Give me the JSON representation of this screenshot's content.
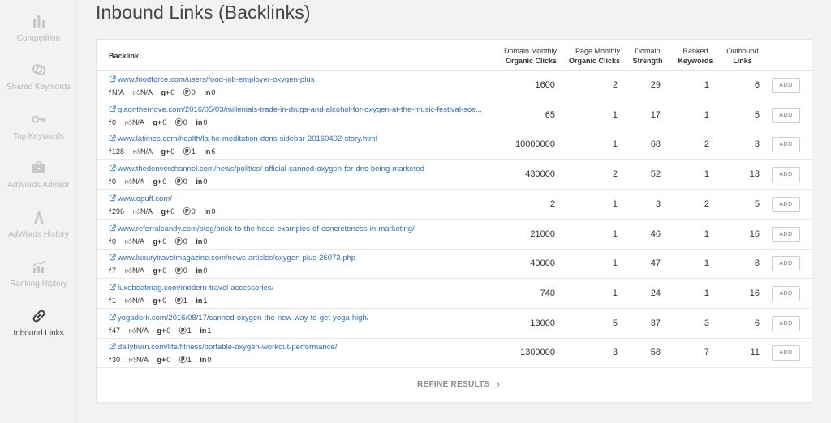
{
  "page_title": "Inbound Links (Backlinks)",
  "sidebar": {
    "items": [
      {
        "label": "Competition",
        "icon": "bar-chart-icon"
      },
      {
        "label": "Shared Keywords",
        "icon": "shared-keywords-icon"
      },
      {
        "label": "Top Keywords",
        "icon": "key-icon"
      },
      {
        "label": "AdWords Advisor",
        "icon": "briefcase-icon"
      },
      {
        "label": "AdWords History",
        "icon": "adwords-icon"
      },
      {
        "label": "Ranking History",
        "icon": "ranking-chart-icon"
      },
      {
        "label": "Inbound Links",
        "icon": "link-icon",
        "active": true
      }
    ]
  },
  "table": {
    "headers": {
      "backlink": "Backlink",
      "domain_monthly_1": "Domain Monthly",
      "domain_monthly_2": "Organic Clicks",
      "page_monthly_1": "Page Monthly",
      "page_monthly_2": "Organic Clicks",
      "domain_strength_1": "Domain",
      "domain_strength_2": "Strength",
      "ranked_keywords_1": "Ranked",
      "ranked_keywords_2": "Keywords",
      "outbound_links_1": "Outbound",
      "outbound_links_2": "Links"
    },
    "add_label": "ADD",
    "rows": [
      {
        "url": "www.foodforce.com/users/food-job-employer-oxygen-plus",
        "fb": "N/A",
        "like": "N/A",
        "gplus": "0",
        "pin": "0",
        "li": "0",
        "domain_clicks": "1600",
        "page_clicks": "2",
        "strength": "29",
        "ranked": "1",
        "outbound": "6"
      },
      {
        "url": "giaonthemove.com/2016/05/03/millenials-trade-in-drugs-and-alcohol-for-oxygen-at-the-music-festival-sce...",
        "fb": "0",
        "like": "N/A",
        "gplus": "0",
        "pin": "0",
        "li": "0",
        "domain_clicks": "65",
        "page_clicks": "1",
        "strength": "17",
        "ranked": "1",
        "outbound": "5"
      },
      {
        "url": "www.latimes.com/health/la-he-meditation-dens-sidebar-20160402-story.html",
        "fb": "128",
        "like": "N/A",
        "gplus": "0",
        "pin": "1",
        "li": "6",
        "domain_clicks": "10000000",
        "page_clicks": "1",
        "strength": "68",
        "ranked": "2",
        "outbound": "3"
      },
      {
        "url": "www.thedenverchannel.com/news/politics/-official-canned-oxygen-for-dnc-being-marketed",
        "fb": "0",
        "like": "N/A",
        "gplus": "0",
        "pin": "0",
        "li": "0",
        "domain_clicks": "430000",
        "page_clicks": "2",
        "strength": "52",
        "ranked": "1",
        "outbound": "13"
      },
      {
        "url": "www.opuff.com/",
        "fb": "296",
        "like": "N/A",
        "gplus": "0",
        "pin": "0",
        "li": "0",
        "domain_clicks": "2",
        "page_clicks": "1",
        "strength": "3",
        "ranked": "2",
        "outbound": "5"
      },
      {
        "url": "www.referralcandy.com/blog/brick-to-the-head-examples-of-concreteness-in-marketing/",
        "fb": "0",
        "like": "N/A",
        "gplus": "0",
        "pin": "0",
        "li": "0",
        "domain_clicks": "21000",
        "page_clicks": "1",
        "strength": "46",
        "ranked": "1",
        "outbound": "16"
      },
      {
        "url": "www.luxurytravelmagazine.com/news-articles/oxygen-plus-26073.php",
        "fb": "7",
        "like": "N/A",
        "gplus": "0",
        "pin": "0",
        "li": "0",
        "domain_clicks": "40000",
        "page_clicks": "1",
        "strength": "47",
        "ranked": "1",
        "outbound": "8"
      },
      {
        "url": "luxebeatmag.com/modern-travel-accessories/",
        "fb": "1",
        "like": "N/A",
        "gplus": "0",
        "pin": "1",
        "li": "1",
        "domain_clicks": "740",
        "page_clicks": "1",
        "strength": "24",
        "ranked": "1",
        "outbound": "16"
      },
      {
        "url": "yogadork.com/2016/08/17/canned-oxygen-the-new-way-to-get-yoga-high/",
        "fb": "47",
        "like": "N/A",
        "gplus": "0",
        "pin": "1",
        "li": "1",
        "domain_clicks": "13000",
        "page_clicks": "5",
        "strength": "37",
        "ranked": "3",
        "outbound": "6"
      },
      {
        "url": "dailyburn.com/life/fitness/portable-oxygen-workout-performance/",
        "fb": "30",
        "like": "N/A",
        "gplus": "0",
        "pin": "1",
        "li": "0",
        "domain_clicks": "1300000",
        "page_clicks": "3",
        "strength": "58",
        "ranked": "7",
        "outbound": "11"
      }
    ]
  },
  "refine_label": "REFINE RESULTS",
  "refine_icon": "chevron-right-icon"
}
